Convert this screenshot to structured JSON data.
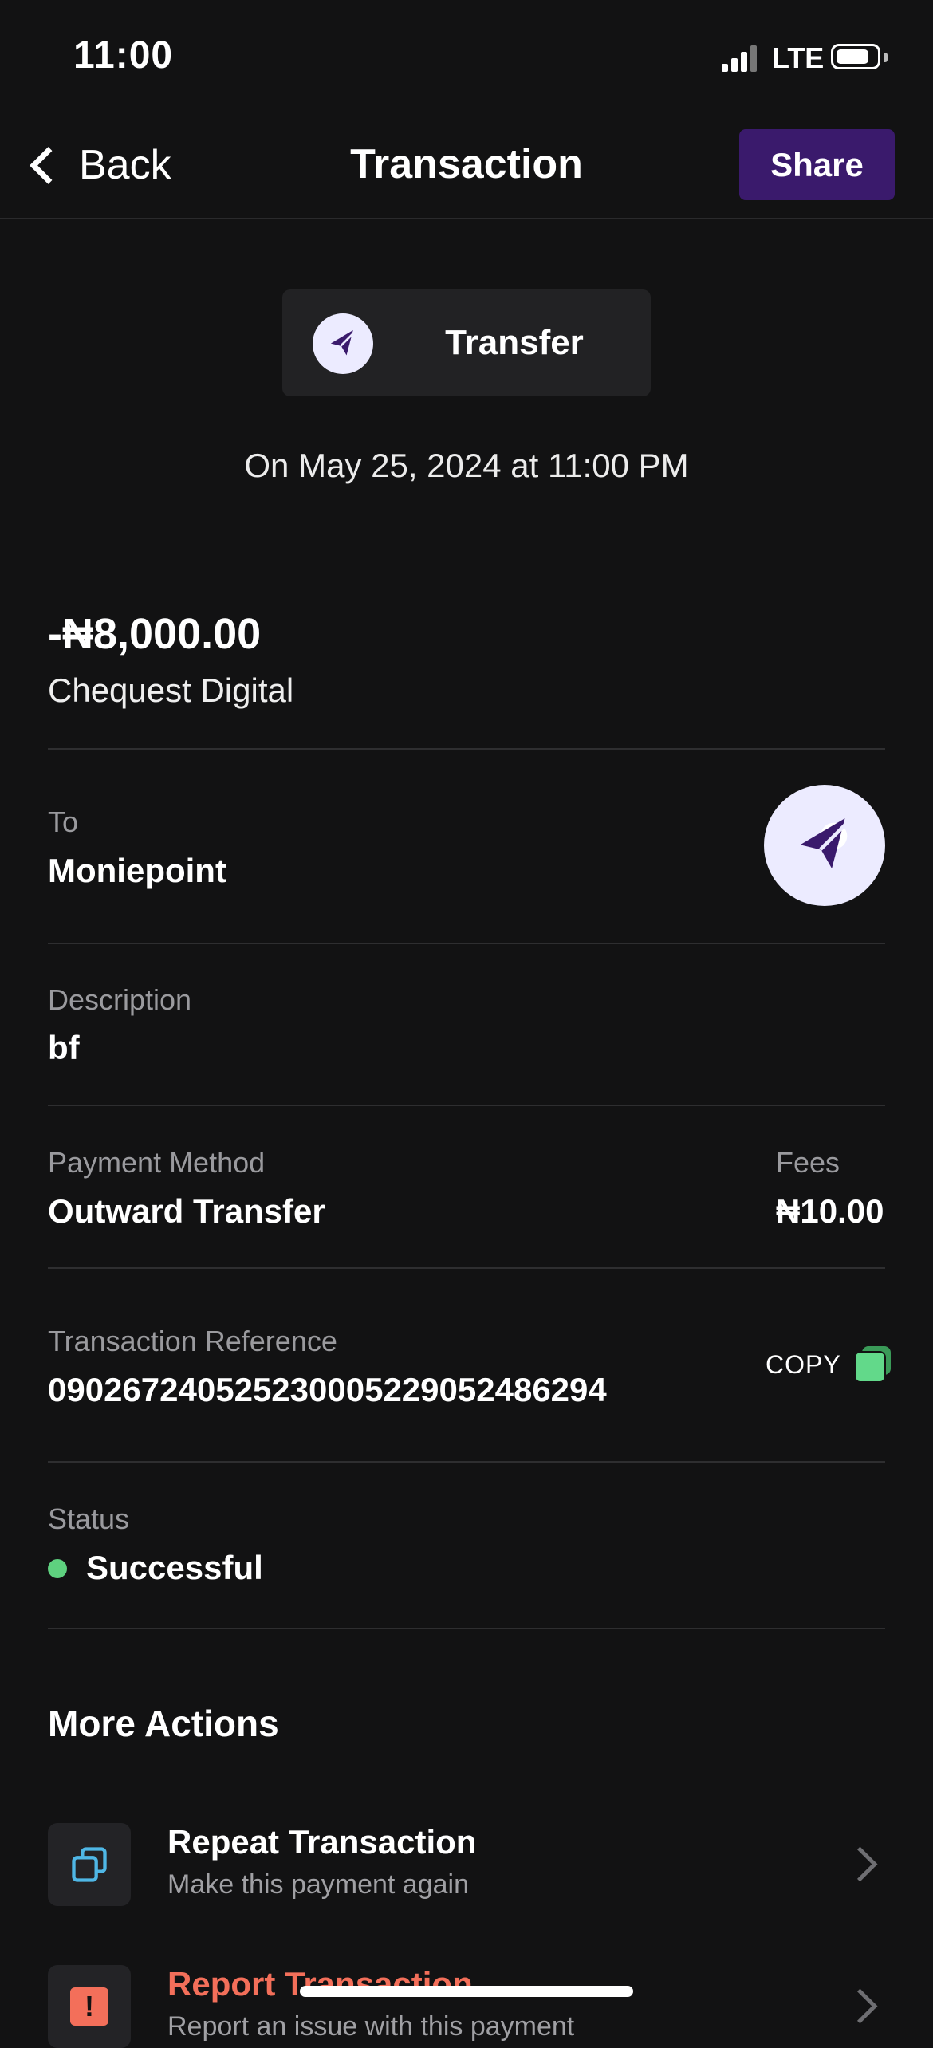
{
  "status_bar": {
    "time": "11:00",
    "network": "LTE"
  },
  "header": {
    "back_label": "Back",
    "title": "Transaction",
    "share_label": "Share"
  },
  "summary": {
    "type_label": "Transfer",
    "date": "On May 25, 2024 at 11:00 PM",
    "amount": "-₦8,000.00",
    "account": "Chequest Digital"
  },
  "details": {
    "to_label": "To",
    "to_value": "Moniepoint",
    "description_label": "Description",
    "description_value": "bf",
    "payment_method_label": "Payment Method",
    "payment_method_value": "Outward Transfer",
    "fees_label": "Fees",
    "fees_value": "₦10.00",
    "reference_label": "Transaction Reference",
    "reference_value": "090267240525230005229052486294",
    "copy_label": "COPY",
    "status_label": "Status",
    "status_value": "Successful"
  },
  "more_actions": {
    "title": "More Actions",
    "items": [
      {
        "title": "Repeat Transaction",
        "subtitle": "Make this payment again",
        "icon": "repeat-icon"
      },
      {
        "title": "Report Transaction",
        "subtitle": "Report an issue with this payment",
        "icon": "report-icon"
      }
    ]
  },
  "colors": {
    "background": "#121213",
    "accent": "#3a1a6c",
    "success": "#5ed17f",
    "danger": "#f36f5a",
    "icon_bg": "#ecebff",
    "icon_fg": "#3a1a6c",
    "repeat_icon": "#4fb7e6"
  }
}
